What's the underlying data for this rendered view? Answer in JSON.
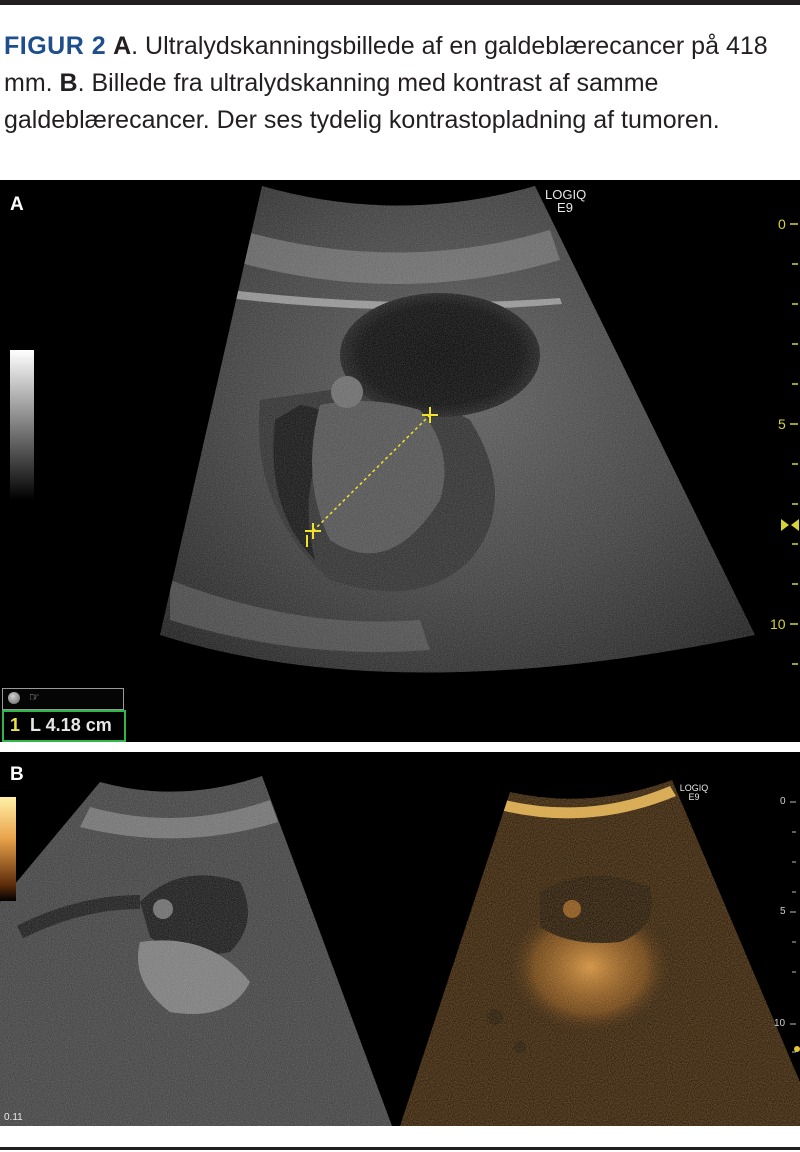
{
  "caption": {
    "figure_label": "FIGUR 2",
    "a_label": "A",
    "a_text": ". Ultralydskanningsbillede af en galdeblærecancer på 418 mm. ",
    "b_label": "B",
    "b_text": ". Billede fra ultralydskanning med kontrast af samme galdeblærecancer. Der ses tydelig kontrastopladning af tumoren."
  },
  "panel_a": {
    "label": "A",
    "logo_line1": "LOGIQ",
    "logo_line2": "E9",
    "depth_ticks": [
      "0",
      "5",
      "10"
    ],
    "measurement_number": "1",
    "measurement_text": "L  4.18 cm",
    "greyscale_bar": "greyscale-bar",
    "cursor_icon": "hand-cursor-icon"
  },
  "panel_b": {
    "label": "B",
    "logo_line1": "LOGIQ",
    "logo_line2": "E9",
    "depth_ticks": [
      "0",
      "5",
      "10"
    ],
    "bottom_left_text": "0.11",
    "contrast_colormap": "orange-contrast-bar"
  },
  "colors": {
    "figure_label": "#1f4e8c",
    "caliper": "#f0e32a",
    "measurement_border": "#2fb84a",
    "contrast_tint": "#e9a24a"
  }
}
